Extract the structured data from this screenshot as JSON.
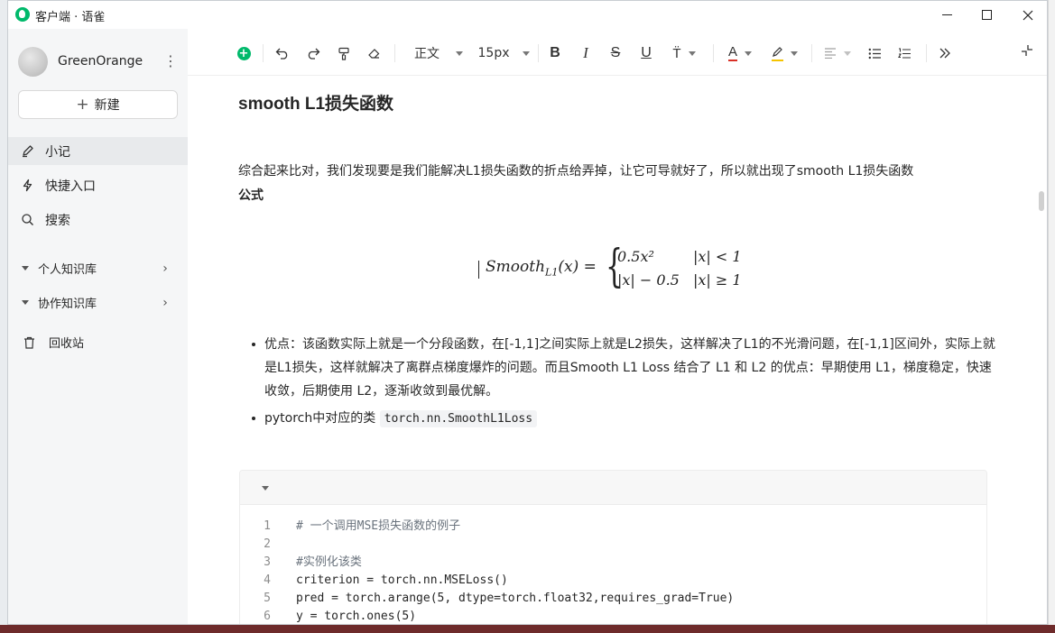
{
  "window": {
    "title": "客户端 · 语雀"
  },
  "sidebar": {
    "username": "GreenOrange",
    "new_button": "新建",
    "items": [
      {
        "label": "小记",
        "icon": "pen-icon"
      },
      {
        "label": "快捷入口",
        "icon": "lightning-icon"
      },
      {
        "label": "搜索",
        "icon": "search-icon"
      }
    ],
    "groups": [
      {
        "label": "个人知识库"
      },
      {
        "label": "协作知识库"
      }
    ],
    "trash": "回收站"
  },
  "toolbar": {
    "paragraph_style": "正文",
    "font_size": "15px"
  },
  "doc": {
    "heading": "smooth L1损失函数",
    "paragraph": "综合起来比对，我们发现要是我们能解决L1损失函数的折点给弄掉，让它可导就好了，所以就出现了smooth L1损失函数",
    "formula_label": "公式",
    "formula": {
      "lhs_name": "Smooth",
      "lhs_sub": "L1",
      "lhs_arg": "(x) =",
      "row1_expr": "0.5x²",
      "row1_cond": "|x| < 1",
      "row2_expr": "|x| − 0.5",
      "row2_cond": "|x| ≥ 1"
    },
    "bullet1": "优点：该函数实际上就是一个分段函数，在[-1,1]之间实际上就是L2损失，这样解决了L1的不光滑问题，在[-1,1]区间外，实际上就是L1损失，这样就解决了离群点梯度爆炸的问题。而且Smooth L1 Loss 结合了 L1 和 L2 的优点：早期使用 L1，梯度稳定，快速收敛，后期使用 L2，逐渐收敛到最优解。",
    "bullet2_text": "pytorch中对应的类 ",
    "bullet2_code": "torch.nn.SmoothL1Loss",
    "code_lines": [
      {
        "n": "1",
        "text": "# 一个调用MSE损失函数的例子"
      },
      {
        "n": "2",
        "text": ""
      },
      {
        "n": "3",
        "text": "#实例化该类"
      },
      {
        "n": "4",
        "text": "criterion = torch.nn.MSELoss()"
      },
      {
        "n": "5",
        "text": "pred = torch.arange(5, dtype=torch.float32,requires_grad=True)"
      },
      {
        "n": "6",
        "text": "y = torch.ones(5)"
      }
    ]
  },
  "colors": {
    "brand": "#00b96b",
    "font_color_underline": "#d93026",
    "highlight_underline": "#f5c400"
  }
}
